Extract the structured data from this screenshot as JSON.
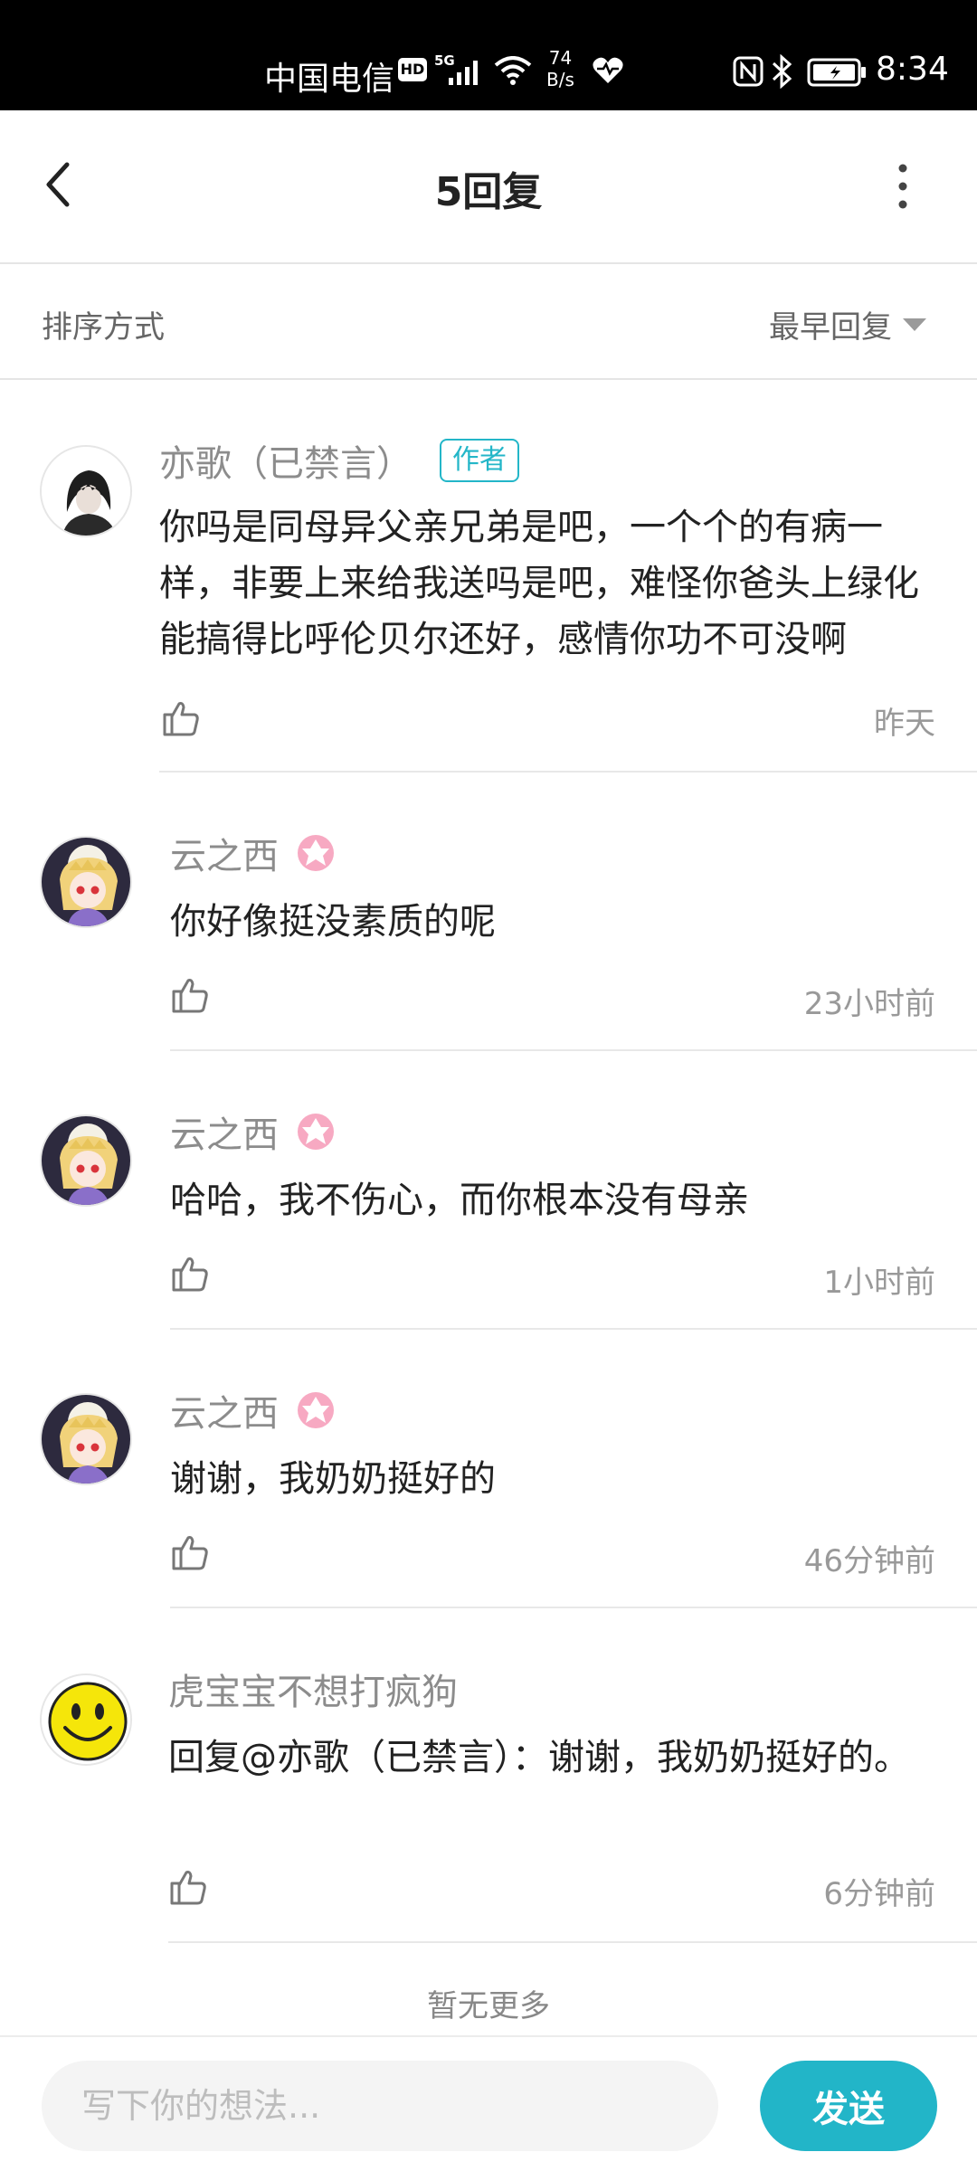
{
  "status_bar": {
    "carrier": "中国电信",
    "hd": "HD",
    "network": "5G",
    "speed_value": "74",
    "speed_unit": "B/s",
    "time": "8:34"
  },
  "header": {
    "title": "5回复",
    "back_icon": "chevron-left-icon",
    "more_icon": "more-vertical-icon"
  },
  "sort": {
    "label": "排序方式",
    "selected": "最早回复"
  },
  "replies": [
    {
      "username": "亦歌（已禁言）",
      "tag": "作者",
      "content": "你吗是同母异父亲兄弟是吧，一个个的有病一样，非要上来给我送吗是吧，难怪你爸头上绿化能搞得比呼伦贝尔还好，感情你功不可没啊",
      "time": "昨天",
      "avatar": "dark-anime-avatar"
    },
    {
      "username": "云之西",
      "content": "你好像挺没素质的呢",
      "time": "23小时前",
      "avatar": "anime-girl-avatar"
    },
    {
      "username": "云之西",
      "content": "哈哈，我不伤心，而你根本没有母亲",
      "time": "1小时前",
      "avatar": "anime-girl-avatar"
    },
    {
      "username": "云之西",
      "content": "谢谢，我奶奶挺好的",
      "time": "46分钟前",
      "avatar": "anime-girl-avatar"
    },
    {
      "username": "虎宝宝不想打疯狗",
      "reply_prefix": "回复",
      "mention": "@亦歌（已禁言）",
      "content": "：谢谢，我奶奶挺好的。",
      "time": "6分钟前",
      "avatar": "smiley-face-avatar"
    }
  ],
  "footer": {
    "no_more": "暂无更多",
    "input_placeholder": "写下你的想法...",
    "send_label": "发送"
  },
  "colors": {
    "accent": "#22b5c8",
    "badge_pink": "#f47fa6"
  }
}
